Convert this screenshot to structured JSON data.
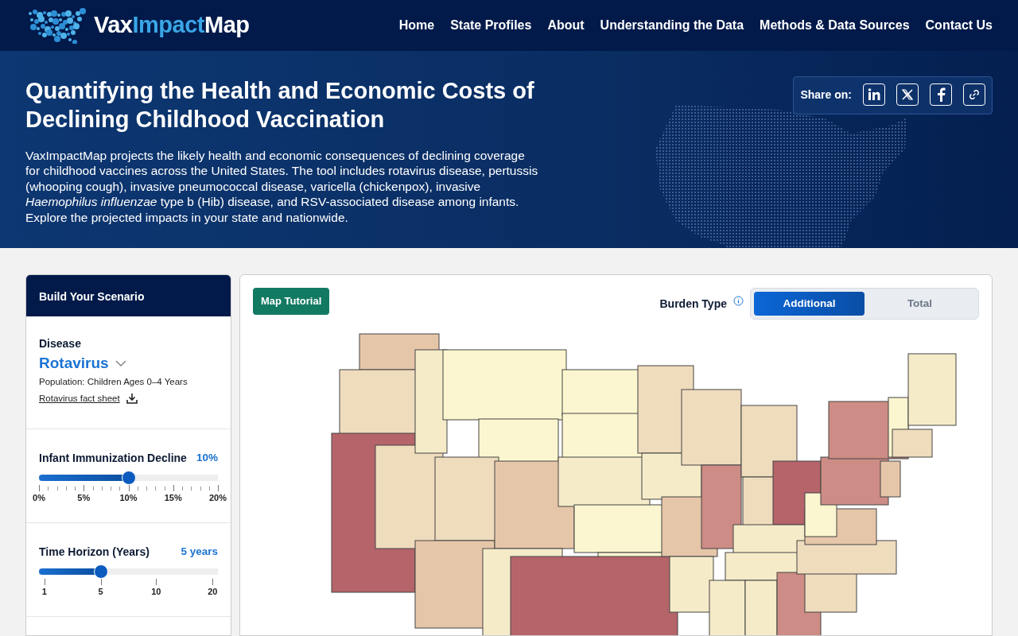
{
  "brand": {
    "parts": [
      "Vax",
      "Impact",
      "Map"
    ]
  },
  "nav": [
    {
      "label": "Home"
    },
    {
      "label": "State Profiles"
    },
    {
      "label": "About"
    },
    {
      "label": "Understanding the Data"
    },
    {
      "label": "Methods & Data Sources"
    },
    {
      "label": "Contact Us"
    }
  ],
  "hero": {
    "title": "Quantifying the Health and Economic Costs of Declining Childhood Vaccination",
    "description": "VaxImpactMap projects the likely health and economic consequences of declining coverage for childhood vaccines across the United States. The tool includes rotavirus disease, pertussis (whooping cough), invasive pneumococcal disease, varicella (chickenpox), invasive *Haemophilus influenzae* type b (Hib) disease, and RSV-associated disease among infants. Explore the projected impacts in your state and nationwide.",
    "share": {
      "label": "Share on:",
      "buttons": [
        {
          "kind": "linkedin"
        },
        {
          "kind": "x"
        },
        {
          "kind": "facebook"
        },
        {
          "kind": "link"
        }
      ]
    }
  },
  "scenario": {
    "title": "Build Your Scenario",
    "disease": {
      "label": "Disease",
      "value": "Rotavirus",
      "population": "Population: Children Ages 0–4 Years",
      "fact_sheet": "Rotavirus fact sheet"
    },
    "sliders": [
      {
        "label": "Infant Immunization Decline",
        "reading": "10%",
        "level": 0.5,
        "minor_ticks": true,
        "ticks": [
          "0%",
          "5%",
          "10%",
          "15%",
          "20%"
        ]
      },
      {
        "label": "Time Horizon (Years)",
        "reading": "5 years",
        "level": 0.345,
        "minor_ticks": false,
        "ticks": [
          "1",
          "5",
          "10",
          "20"
        ]
      }
    ]
  },
  "map_panel": {
    "tutorial_button": "Map Tutorial",
    "burden_type": {
      "label": "Burden Type",
      "options": [
        {
          "label": "Additional",
          "selected": true
        },
        {
          "label": "Total",
          "selected": false
        }
      ]
    }
  }
}
